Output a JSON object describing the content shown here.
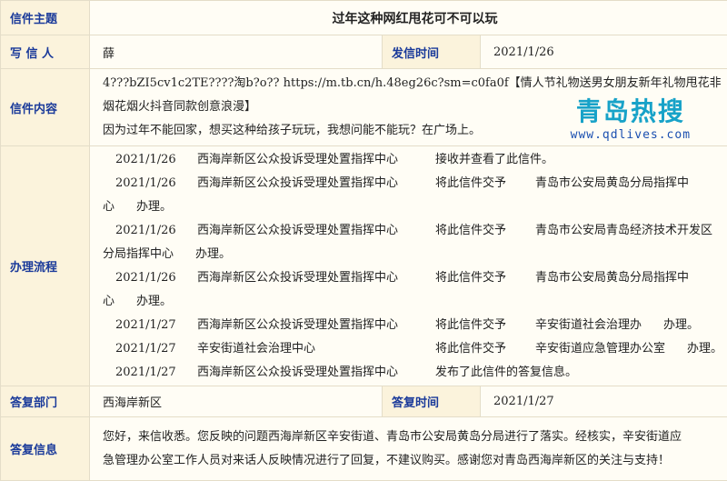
{
  "subject": {
    "label": "信件主题",
    "value": "过年这种网红甩花可不可以玩"
  },
  "writer": {
    "label": "写 信 人",
    "value": "薛"
  },
  "send_time": {
    "label": "发信时间",
    "value": "2021/1/26"
  },
  "content": {
    "label": "信件内容",
    "line1": "4???bZI5cv1c2TE????淘b?o?? https://m.tb.cn/h.48eg26c?sm=c0fa0f【情人节礼物送男女朋友新年礼物甩花非",
    "line2": "烟花烟火抖音同款创意浪漫】",
    "line3": "因为过年不能回家，想买这种给孩子玩玩，我想问能不能玩？在广场上。"
  },
  "watermark": {
    "title": "青岛热搜",
    "url": "www.qdlives.com"
  },
  "process": {
    "label": "办理流程",
    "steps": [
      {
        "date": "2021/1/26",
        "org": "西海岸新区公众投诉受理处置指挥中心",
        "action": "接收并查看了此信件。",
        "target": "",
        "end": ""
      },
      {
        "date": "2021/1/26",
        "org": "西海岸新区公众投诉受理处置指挥中心",
        "action": "将此信件交予",
        "target": "青岛市公安局黄岛分局指挥中",
        "cont": "心",
        "end": "办理。"
      },
      {
        "date": "2021/1/26",
        "org": "西海岸新区公众投诉受理处置指挥中心",
        "action": "将此信件交予",
        "target": "青岛市公安局青岛经济技术开发区",
        "cont": "分局指挥中心",
        "end": "办理。"
      },
      {
        "date": "2021/1/26",
        "org": "西海岸新区公众投诉受理处置指挥中心",
        "action": "将此信件交予",
        "target": "青岛市公安局黄岛分局指挥中",
        "cont": "心",
        "end": "办理。"
      },
      {
        "date": "2021/1/27",
        "org": "西海岸新区公众投诉受理处置指挥中心",
        "action": "将此信件交予",
        "target": "辛安街道社会治理办",
        "end": "办理。"
      },
      {
        "date": "2021/1/27",
        "org": "辛安街道社会治理中心",
        "action": "将此信件交予",
        "target": "辛安街道应急管理办公室",
        "end": "办理。"
      },
      {
        "date": "2021/1/27",
        "org": "西海岸新区公众投诉受理处置指挥中心",
        "action": "发布了此信件的答复信息。",
        "target": "",
        "end": ""
      }
    ]
  },
  "reply_dept": {
    "label": "答复部门",
    "value": "西海岸新区"
  },
  "reply_time": {
    "label": "答复时间",
    "value": "2021/1/27"
  },
  "reply": {
    "label": "答复信息",
    "line1": "您好，来信收悉。您反映的问题西海岸新区辛安街道、青岛市公安局黄岛分局进行了落实。经核实，辛安街道应",
    "line2": "急管理办公室工作人员对来话人反映情况进行了回复，不建议购买。感谢您对青岛西海岸新区的关注与支持！"
  }
}
